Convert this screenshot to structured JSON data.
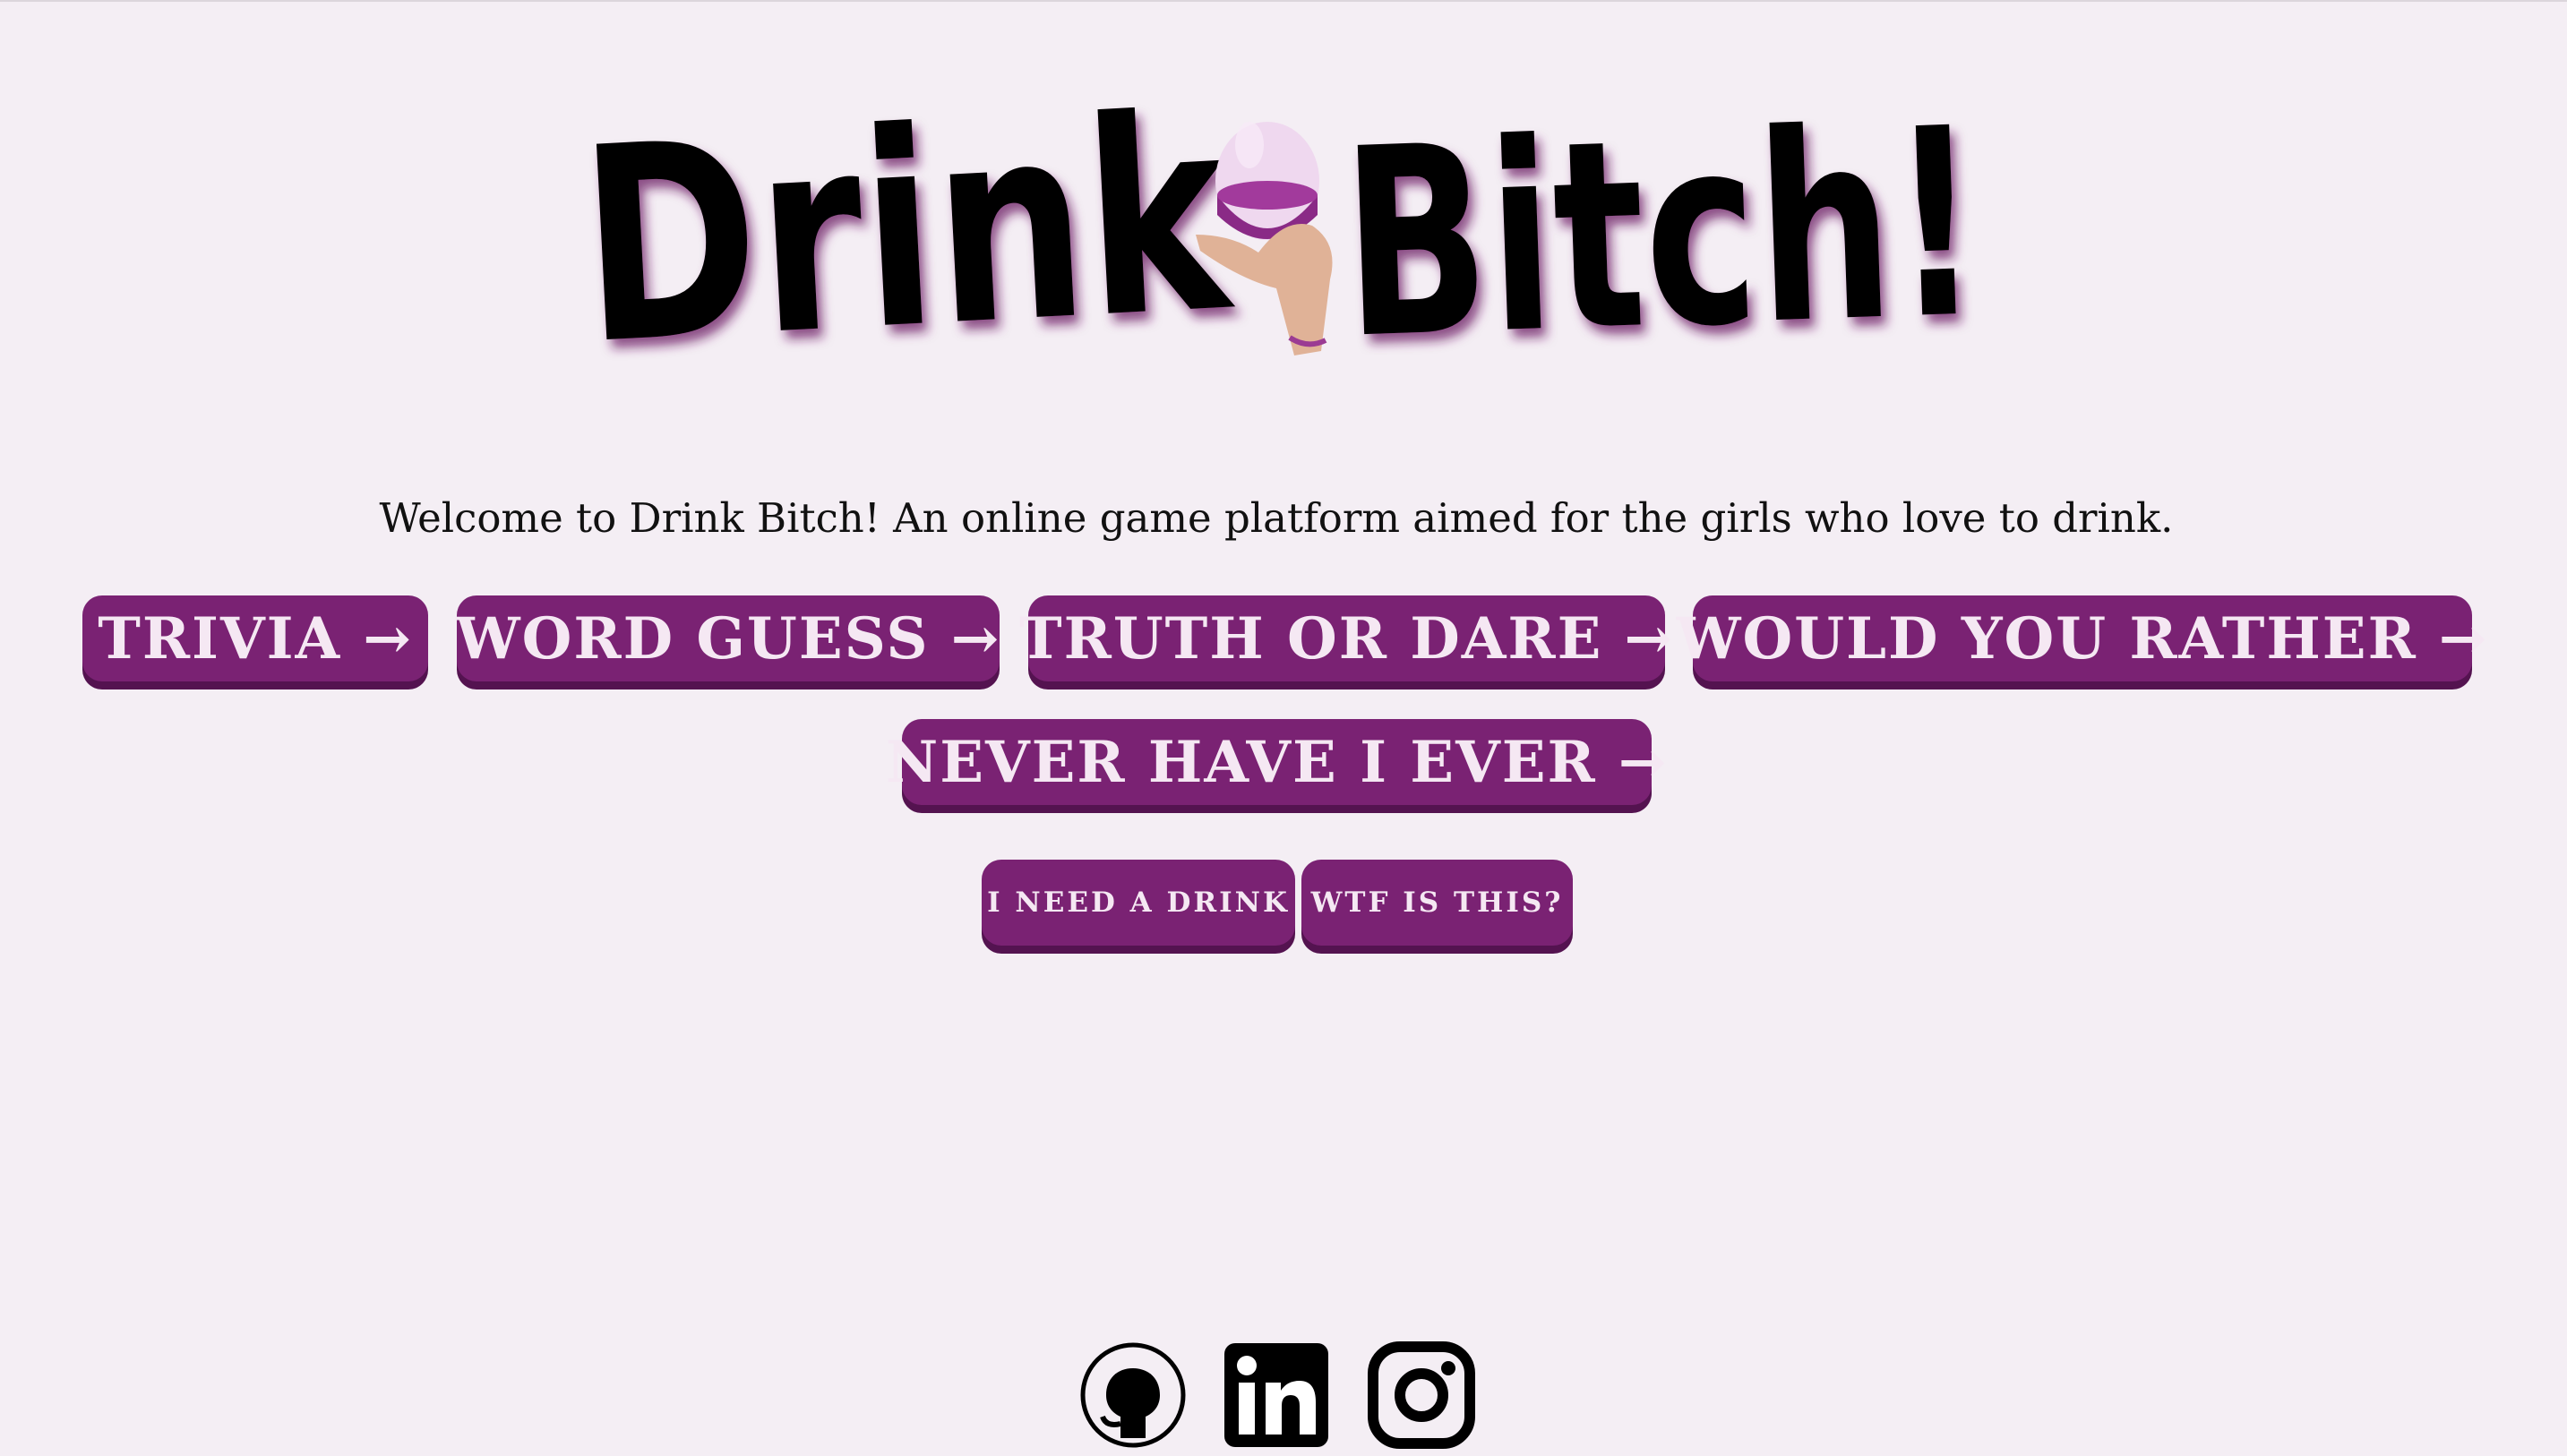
{
  "logo": {
    "text_part1": "Drink",
    "text_part2": "Bitch!",
    "icon": "wine-glass-in-hand-icon"
  },
  "welcome_text": "Welcome to Drink Bitch! An online game platform aimed for the girls who love to drink.",
  "games": [
    {
      "label": "TRIVIA",
      "arrow": "→"
    },
    {
      "label": "WORD GUESS",
      "arrow": "→"
    },
    {
      "label": "TRUTH OR DARE",
      "arrow": "→"
    },
    {
      "label": "WOULD YOU RATHER",
      "arrow": "→"
    },
    {
      "label": "NEVER HAVE I EVER",
      "arrow": "→"
    }
  ],
  "actions": [
    {
      "label": "I NEED A DRINK"
    },
    {
      "label": "WTF IS THIS?"
    }
  ],
  "socials": [
    {
      "icon": "github-icon"
    },
    {
      "icon": "linkedin-icon"
    },
    {
      "icon": "instagram-icon"
    }
  ],
  "colors": {
    "background": "#f4eef4",
    "button": "#7a2273",
    "button_shadow": "#541350",
    "button_text": "#f5e8f3"
  }
}
